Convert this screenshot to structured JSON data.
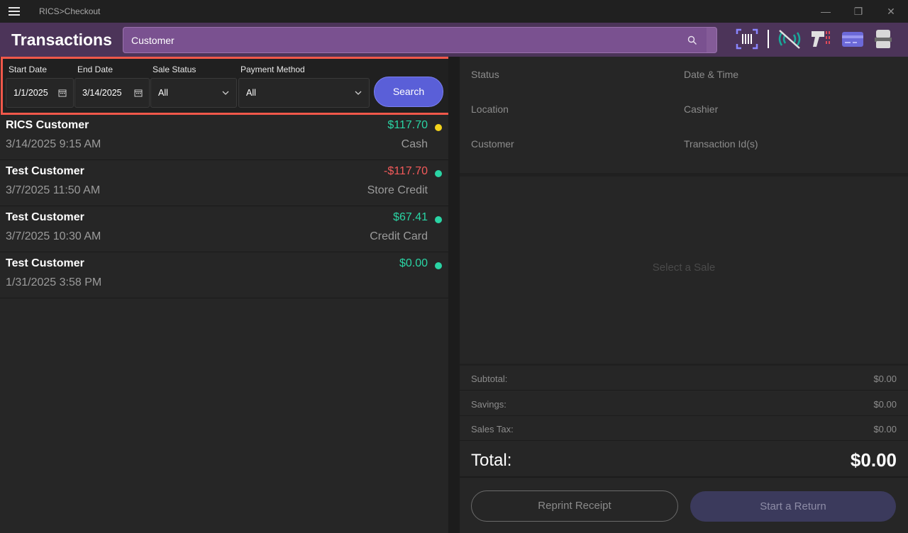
{
  "app": {
    "title": "RICS>Checkout"
  },
  "header": {
    "title": "Transactions",
    "search_value": "Customer",
    "icons": [
      "barcode-scanner-icon",
      "wireless-off-icon",
      "handheld-scanner-icon",
      "card-reader-icon",
      "receipt-printer-icon"
    ]
  },
  "filters": {
    "start_date_label": "Start Date",
    "start_date": "1/1/2025",
    "end_date_label": "End Date",
    "end_date": "3/14/2025",
    "sale_status_label": "Sale Status",
    "sale_status": "All",
    "payment_method_label": "Payment Method",
    "payment_method": "All",
    "search_button": "Search"
  },
  "transactions": [
    {
      "customer": "RICS Customer",
      "datetime": "3/14/2025 9:15 AM",
      "amount": "$117.70",
      "method": "Cash",
      "amount_color": "#2ad4a4",
      "status_color": "#f2d21b"
    },
    {
      "customer": "Test Customer",
      "datetime": "3/7/2025 11:50 AM",
      "amount": "-$117.70",
      "method": "Store Credit",
      "amount_color": "#f25a5a",
      "status_color": "#2ad4a4"
    },
    {
      "customer": "Test Customer",
      "datetime": "3/7/2025 10:30 AM",
      "amount": "$67.41",
      "method": "Credit Card",
      "amount_color": "#2ad4a4",
      "status_color": "#2ad4a4"
    },
    {
      "customer": "Test Customer",
      "datetime": "1/31/2025 3:58 PM",
      "amount": "$0.00",
      "method": "",
      "amount_color": "#2ad4a4",
      "status_color": "#2ad4a4"
    }
  ],
  "details": {
    "status_label": "Status",
    "datetime_label": "Date & Time",
    "location_label": "Location",
    "cashier_label": "Cashier",
    "customer_label": "Customer",
    "transaction_ids_label": "Transaction Id(s)"
  },
  "sale_placeholder": "Select a Sale",
  "totals": {
    "subtotal_label": "Subtotal:",
    "subtotal": "$0.00",
    "savings_label": "Savings:",
    "savings": "$0.00",
    "tax_label": "Sales Tax:",
    "tax": "$0.00",
    "total_label": "Total:",
    "total": "$0.00"
  },
  "actions": {
    "reprint": "Reprint Receipt",
    "return": "Start a Return"
  }
}
